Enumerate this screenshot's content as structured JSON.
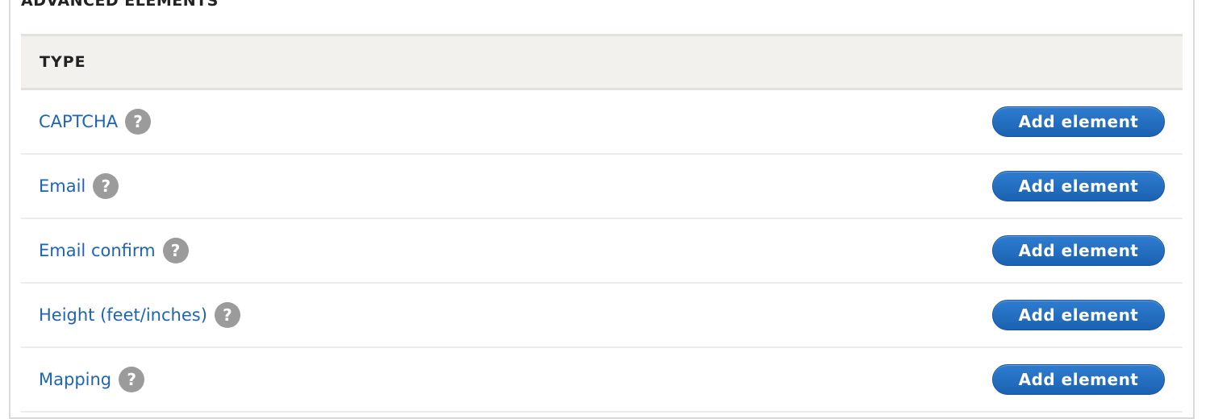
{
  "section": {
    "title": "ADVANCED ELEMENTS"
  },
  "table": {
    "header": "TYPE",
    "help_glyph": "?",
    "rows": [
      {
        "label": "CAPTCHA",
        "button": "Add element"
      },
      {
        "label": "Email",
        "button": "Add element"
      },
      {
        "label": "Email confirm",
        "button": "Add element"
      },
      {
        "label": "Height (feet/inches)",
        "button": "Add element"
      },
      {
        "label": "Mapping",
        "button": "Add element"
      }
    ]
  },
  "colors": {
    "link": "#1e64b4",
    "button": "#1f67b8",
    "header_bg": "#f2f1ee",
    "help_icon": "#9b9b9b"
  }
}
